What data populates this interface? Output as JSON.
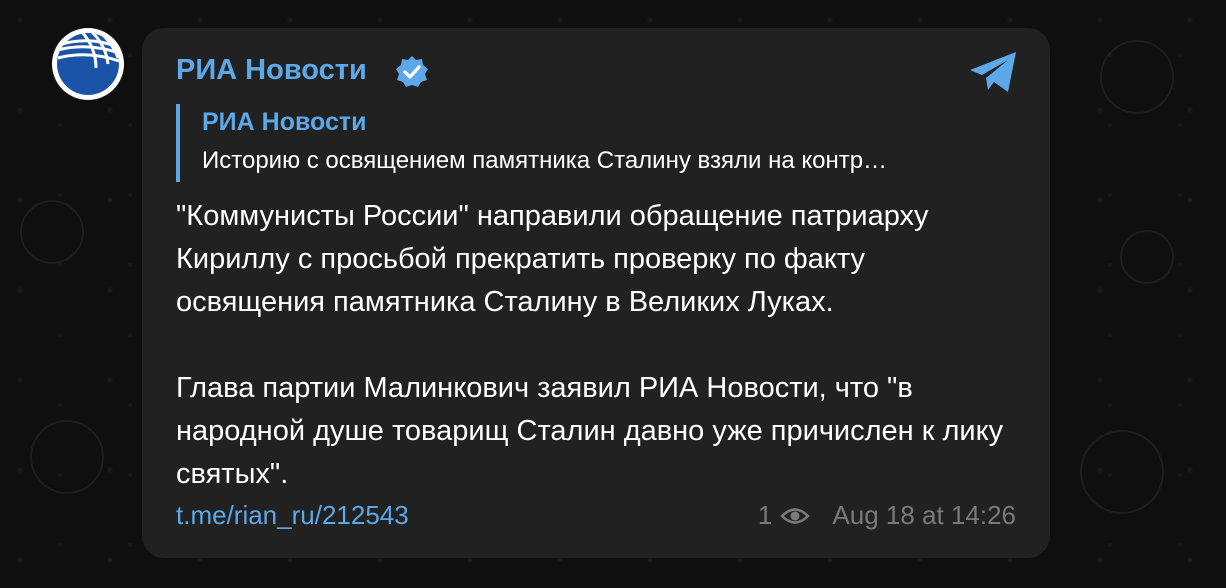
{
  "channel": {
    "name": "РИА Новости",
    "verified": true,
    "avatar_icon": "ria-novosti-logo"
  },
  "reply": {
    "name": "РИА Новости",
    "text": "Историю с освящением памятника Сталину взяли на контр…"
  },
  "message": {
    "paragraphs": [
      "\"Коммунисты России\" направили обращение патриарху Кириллу с просьбой прекратить проверку по факту освящения памятника Сталину в Великих Луках.",
      "Глава партии Малинкович заявил РИА Новости, что \"в народной душе товарищ Сталин давно уже причислен к лику святых\"."
    ],
    "link": "t.me/rian_ru/212543"
  },
  "footer": {
    "views": "1",
    "timestamp": "Aug 18 at 14:26"
  },
  "colors": {
    "accent": "#5ca8e8",
    "bubble": "#212121",
    "background": "#0f0f0f",
    "meta": "#7a7a7a",
    "text": "#ffffff"
  },
  "icons": {
    "verified": "verified-badge-icon",
    "share": "telegram-share-icon",
    "views": "eye-icon"
  }
}
